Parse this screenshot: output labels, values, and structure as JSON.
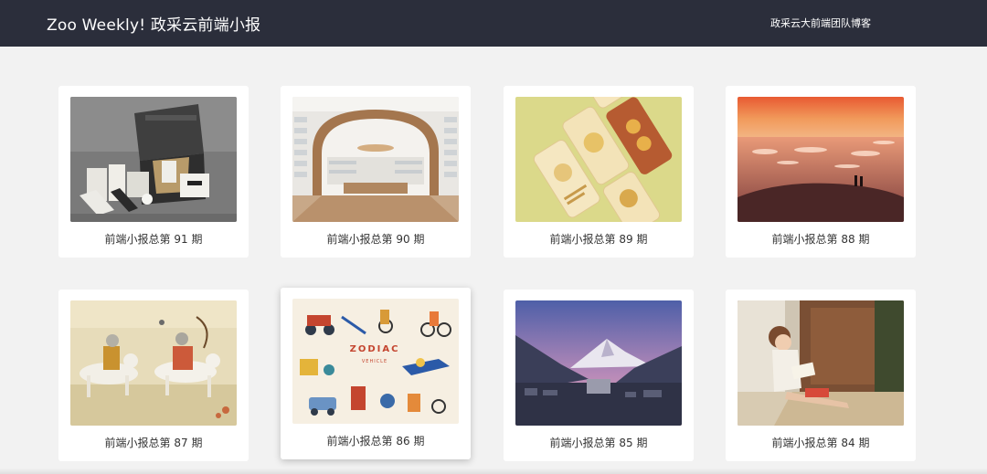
{
  "header": {
    "title": "Zoo Weekly! 政采云前端小报",
    "blog_link": "政采云大前端团队博客"
  },
  "issues": [
    {
      "caption": "前端小报总第 91 期",
      "image": "product-packaging-photo"
    },
    {
      "caption": "前端小报总第 90 期",
      "image": "arched-store-interior-photo"
    },
    {
      "caption": "前端小报总第 89 期",
      "image": "mobile-app-mockups-illustration"
    },
    {
      "caption": "前端小报总第 88 期",
      "image": "sunset-ice-lake-photo"
    },
    {
      "caption": "前端小报总第 87 期",
      "image": "horse-riders-painting"
    },
    {
      "caption": "前端小报总第 86 期",
      "image": "zodiac-vehicle-illustration"
    },
    {
      "caption": "前端小报总第 85 期",
      "image": "mountain-dusk-photo"
    },
    {
      "caption": "前端小报总第 84 期",
      "image": "girl-reading-illustration"
    }
  ],
  "artwork_text": {
    "zodiac": "ZODIAC",
    "vehicle": "VEHICLE"
  },
  "colors": {
    "header_bg": "#2b2e3b",
    "page_bg": "#f2f2f2",
    "card_bg": "#ffffff"
  }
}
